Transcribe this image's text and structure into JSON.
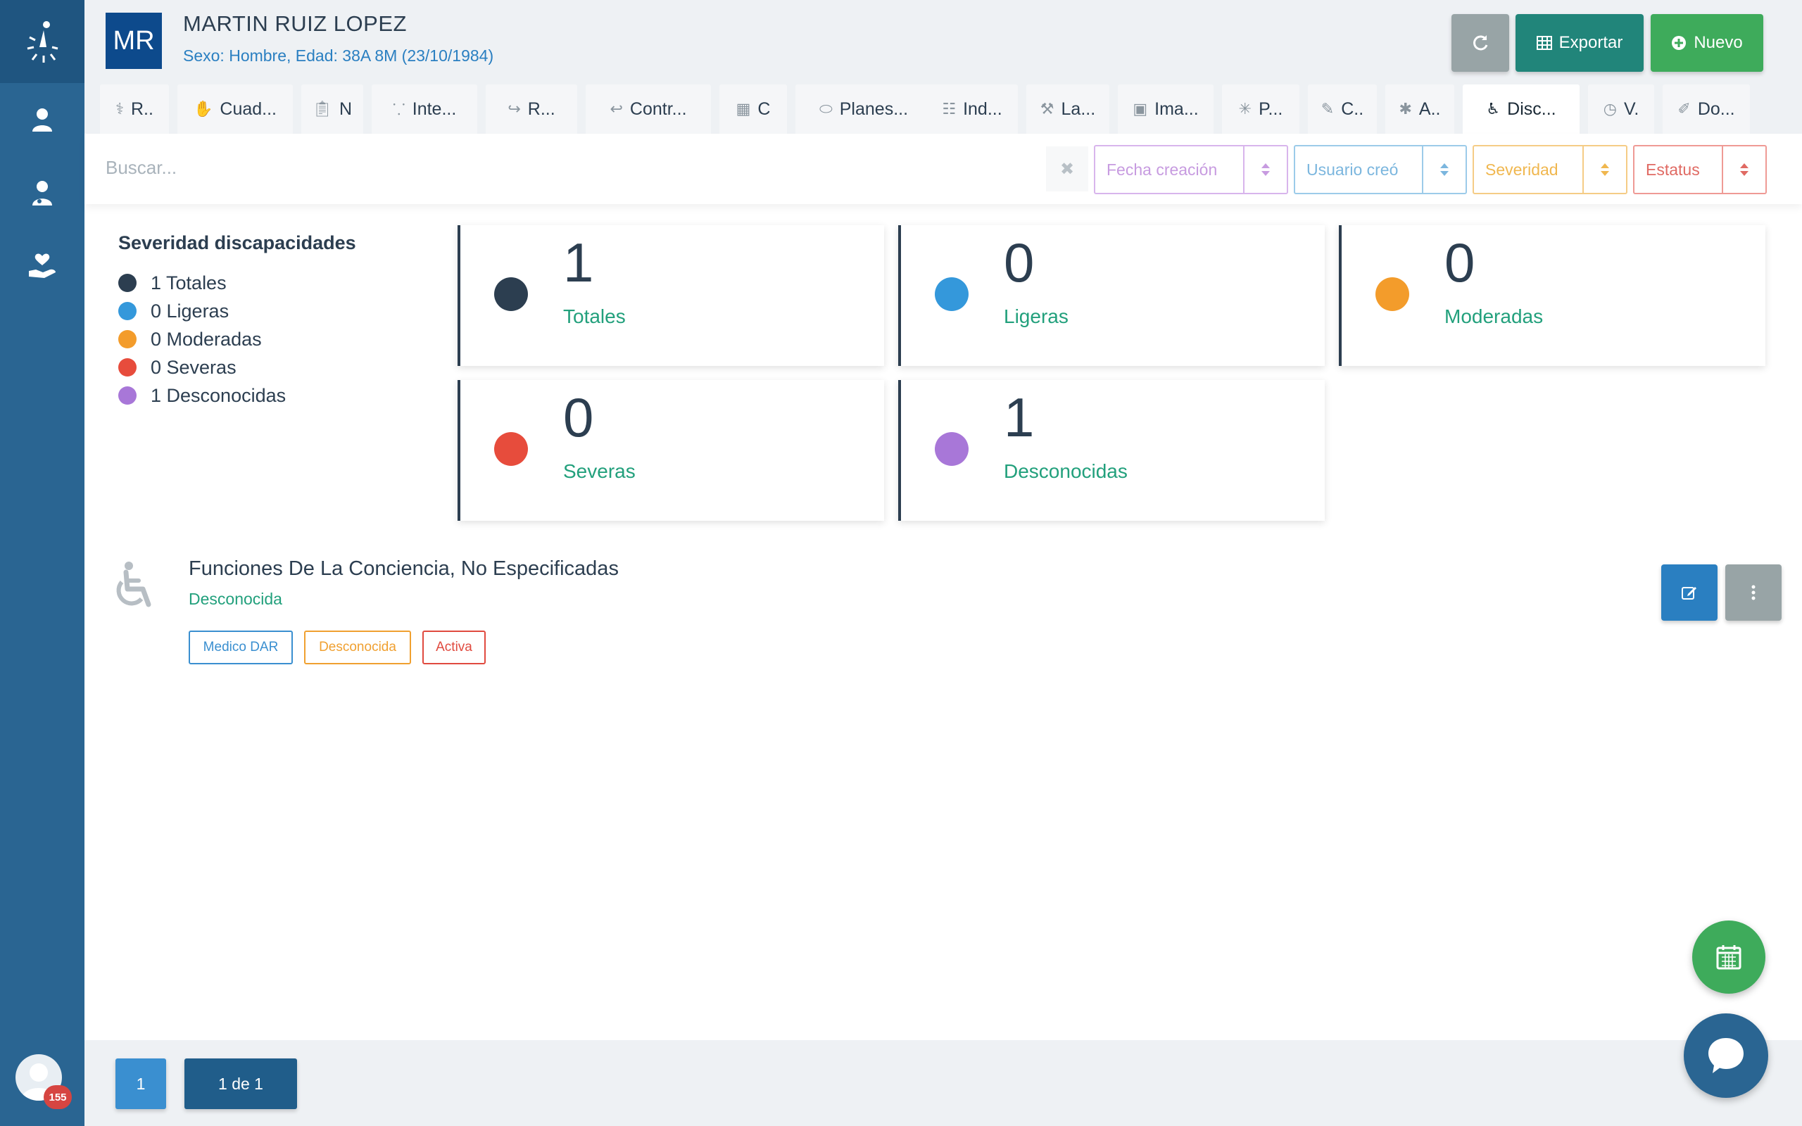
{
  "sidebar": {
    "logo_icon": "sparkle-person-logo",
    "items": [
      {
        "icon": "user-icon"
      },
      {
        "icon": "doctor-icon"
      },
      {
        "icon": "heart-hand-icon"
      }
    ],
    "notification_count": "155"
  },
  "header": {
    "initials": "MR",
    "patient_name": "MARTIN RUIZ LOPEZ",
    "patient_info": "Sexo: Hombre, Edad: 38A 8M (23/10/1984)",
    "export_label": "Exportar",
    "new_label": "Nuevo"
  },
  "tabs": [
    {
      "label": "R..",
      "icon": "medical-kit-icon"
    },
    {
      "label": "Cuad...",
      "icon": "hand-icon"
    },
    {
      "label": "N",
      "icon": "clipboard-icon"
    },
    {
      "label": "Inte...",
      "icon": "molecules-icon"
    },
    {
      "label": "R...",
      "icon": "share-icon"
    },
    {
      "label": "Contr...",
      "icon": "reply-icon"
    },
    {
      "label": "C",
      "icon": "calendar-icon"
    },
    {
      "label": "Planes...",
      "icon": "pills-icon"
    },
    {
      "label": "Ind...",
      "icon": "document-icon"
    },
    {
      "label": "La...",
      "icon": "microscope-icon"
    },
    {
      "label": "Ima...",
      "icon": "image-icon"
    },
    {
      "label": "P...",
      "icon": "virus-icon"
    },
    {
      "label": "C..",
      "icon": "pen-icon"
    },
    {
      "label": "A..",
      "icon": "bug-icon"
    },
    {
      "label": "Disc...",
      "icon": "wheelchair-icon"
    },
    {
      "label": "V.",
      "icon": "clock-icon"
    },
    {
      "label": "Do...",
      "icon": "paperclip-icon"
    }
  ],
  "search": {
    "placeholder": "Buscar...",
    "value": ""
  },
  "filters": {
    "fecha": "Fecha creación",
    "usuario": "Usuario creó",
    "severidad": "Severidad",
    "estatus": "Estatus"
  },
  "legend": {
    "title": "Severidad discapacidades",
    "items": [
      {
        "label": "1 Totales",
        "color": "#2c3e50"
      },
      {
        "label": "0 Ligeras",
        "color": "#3498db"
      },
      {
        "label": "0 Moderadas",
        "color": "#f39c2b"
      },
      {
        "label": "0 Severas",
        "color": "#e74c3c"
      },
      {
        "label": "1 Desconocidas",
        "color": "#a877d8"
      }
    ]
  },
  "stats": [
    {
      "value": "1",
      "label": "Totales",
      "color": "#2c3e50"
    },
    {
      "value": "0",
      "label": "Ligeras",
      "color": "#3498db"
    },
    {
      "value": "0",
      "label": "Moderadas",
      "color": "#f39c2b"
    },
    {
      "value": "0",
      "label": "Severas",
      "color": "#e74c3c"
    },
    {
      "value": "1",
      "label": "Desconocidas",
      "color": "#a877d8"
    }
  ],
  "record": {
    "title": "Funciones De La Conciencia, No Especificadas",
    "severity": "Desconocida",
    "tags": [
      "Medico DAR",
      "Desconocida",
      "Activa"
    ]
  },
  "pagination": {
    "current": "1",
    "of": "1 de 1"
  }
}
